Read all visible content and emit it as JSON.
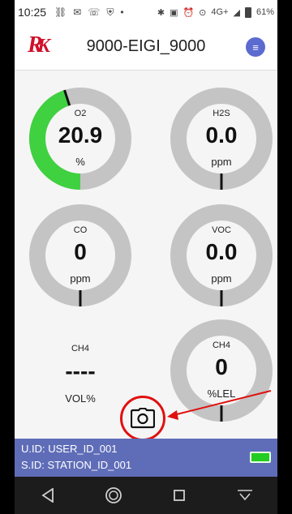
{
  "status_bar": {
    "time": "10:25",
    "network": "4G+",
    "battery": "61%"
  },
  "header": {
    "logo_text": "RIKEN KEIKI",
    "device_name": "9000-EIGI_9000",
    "menu_icon": "list-icon"
  },
  "gauges": [
    {
      "name": "O2",
      "value": "20.9",
      "unit": "%",
      "fill_fraction": 0.45,
      "fill_color": "#3fd13f"
    },
    {
      "name": "H2S",
      "value": "0.0",
      "unit": "ppm",
      "fill_fraction": 0,
      "fill_color": "#3fd13f"
    },
    {
      "name": "CO",
      "value": "0",
      "unit": "ppm",
      "fill_fraction": 0,
      "fill_color": "#3fd13f"
    },
    {
      "name": "VOC",
      "value": "0.0",
      "unit": "ppm",
      "fill_fraction": 0,
      "fill_color": "#3fd13f"
    }
  ],
  "ch4_vol": {
    "name": "CH4",
    "value": "----",
    "unit": "VOL%"
  },
  "ch4_lel": {
    "name": "CH4",
    "value": "0",
    "unit": "%LEL",
    "fill_fraction": 0
  },
  "camera": {
    "icon": "camera-icon"
  },
  "footer": {
    "user_id": "U.ID: USER_ID_001",
    "station_id": "S.ID: STATION_ID_001"
  },
  "colors": {
    "ring": "#c4c4c4",
    "accent": "#5f6db8",
    "annotation": "#e01010",
    "fill": "#3fd13f"
  }
}
